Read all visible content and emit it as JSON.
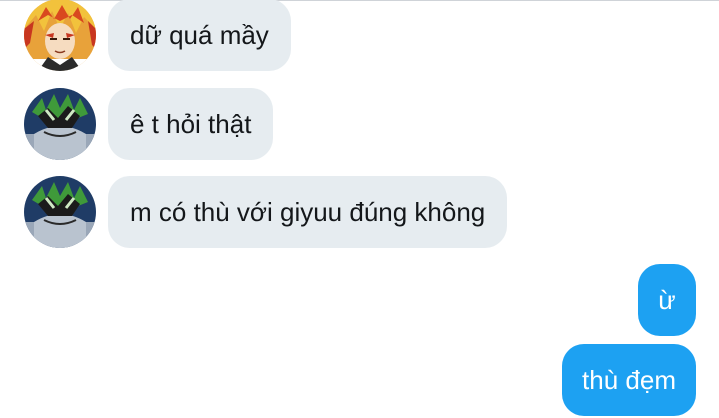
{
  "messages": [
    {
      "direction": "incoming",
      "sender_avatar": "rengoku-avatar",
      "text": "dữ quá mầy"
    },
    {
      "direction": "incoming",
      "sender_avatar": "sanemi-avatar",
      "text": "ê t hỏi thật"
    },
    {
      "direction": "incoming",
      "sender_avatar": "sanemi-avatar",
      "text": "m có thù với giyuu đúng không"
    },
    {
      "direction": "outgoing",
      "text": "ừ"
    },
    {
      "direction": "outgoing",
      "text": "thù đẹm"
    }
  ],
  "colors": {
    "incoming_bubble": "#e6ecf0",
    "outgoing_bubble": "#1da1f2",
    "incoming_text": "#14171a",
    "outgoing_text": "#ffffff"
  }
}
